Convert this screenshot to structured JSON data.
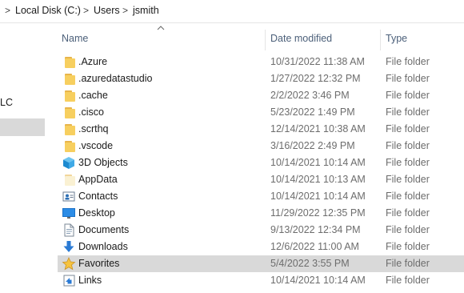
{
  "address_bar": {
    "separator": ">",
    "crumbs": [
      "Local Disk (C:)",
      "Users",
      "jsmith"
    ]
  },
  "nav_pane": {
    "partial_label": "LC"
  },
  "columns": {
    "name": "Name",
    "date_modified": "Date modified",
    "type": "Type"
  },
  "colors": {
    "folder": "#f7cf5f",
    "selection": "#d9d9d9",
    "header_text": "#4c607a"
  },
  "files": [
    {
      "name": ".Azure",
      "date": "10/31/2022 11:38 AM",
      "type": "File folder",
      "icon": "folder-icon"
    },
    {
      "name": ".azuredatastudio",
      "date": "1/27/2022 12:32 PM",
      "type": "File folder",
      "icon": "folder-icon"
    },
    {
      "name": ".cache",
      "date": "2/2/2022 3:46 PM",
      "type": "File folder",
      "icon": "folder-icon"
    },
    {
      "name": ".cisco",
      "date": "5/23/2022 1:49 PM",
      "type": "File folder",
      "icon": "folder-icon"
    },
    {
      "name": ".scrthq",
      "date": "12/14/2021 10:38 AM",
      "type": "File folder",
      "icon": "folder-icon"
    },
    {
      "name": ".vscode",
      "date": "3/16/2022 2:49 PM",
      "type": "File folder",
      "icon": "folder-icon"
    },
    {
      "name": "3D Objects",
      "date": "10/14/2021 10:14 AM",
      "type": "File folder",
      "icon": "3d-objects-icon"
    },
    {
      "name": "AppData",
      "date": "10/14/2021 10:13 AM",
      "type": "File folder",
      "icon": "appdata-folder-icon"
    },
    {
      "name": "Contacts",
      "date": "10/14/2021 10:14 AM",
      "type": "File folder",
      "icon": "contacts-icon"
    },
    {
      "name": "Desktop",
      "date": "11/29/2022 12:35 PM",
      "type": "File folder",
      "icon": "desktop-icon"
    },
    {
      "name": "Documents",
      "date": "9/13/2022 12:34 PM",
      "type": "File folder",
      "icon": "documents-icon"
    },
    {
      "name": "Downloads",
      "date": "12/6/2022 11:00 AM",
      "type": "File folder",
      "icon": "downloads-icon"
    },
    {
      "name": "Favorites",
      "date": "5/4/2022 3:55 PM",
      "type": "File folder",
      "icon": "favorites-star-icon",
      "selected": true
    },
    {
      "name": "Links",
      "date": "10/14/2021 10:14 AM",
      "type": "File folder",
      "icon": "links-icon"
    }
  ]
}
